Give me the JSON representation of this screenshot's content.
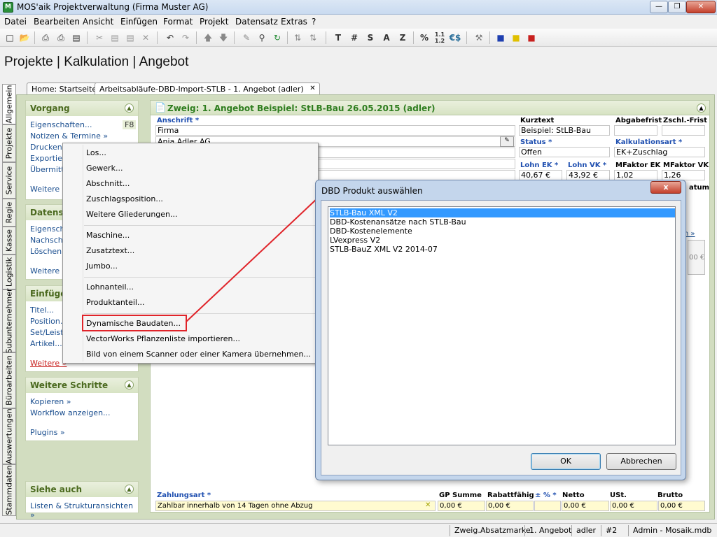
{
  "window": {
    "title": "MOS'aik Projektverwaltung (Firma Muster AG)",
    "app_icon": "M"
  },
  "menu": [
    "Datei",
    "Bearbeiten",
    "Ansicht",
    "Einfügen",
    "Format",
    "Projekt",
    "Datensatz",
    "Extras",
    "?"
  ],
  "toolbar": {
    "letters": [
      "T",
      "#",
      "S",
      "A",
      "Z",
      "%",
      "€$"
    ]
  },
  "page_heading": "Projekte | Kalkulation | Angebot",
  "tabs": {
    "home": "Home: Startseite",
    "doc": "Arbeitsabläufe-DBD-Import-STLB - 1. Angebot (adler)",
    "close": "✕"
  },
  "vtabs": [
    "Allgemein",
    "Projekte",
    "Service",
    "Regie",
    "Kasse",
    "Logistik",
    "Subunternehmer",
    "Büroarbeiten",
    "Auswertungen",
    "Stammdaten"
  ],
  "left": {
    "vorgang": {
      "title": "Vorgang",
      "items": [
        "Eigenschaften...",
        "Notizen & Termine »",
        "Drucken &",
        "Exportier",
        "Übermitte",
        "Weitere F"
      ],
      "shortcut": "F8"
    },
    "datensatz": {
      "title": "Datensa",
      "items": [
        "Eigensche",
        "Nachschla",
        "Löschen",
        "Weitere F"
      ]
    },
    "einfuegen": {
      "title": "Einfüger",
      "items": [
        "Titel...",
        "Position...",
        "Set/Leist",
        "Artikel...",
        "Weitere »"
      ]
    },
    "weitere": {
      "title": "Weitere Schritte",
      "items": [
        "Kopieren »",
        "Workflow anzeigen...",
        "Plugins »"
      ]
    },
    "siehe": {
      "title": "Siehe auch",
      "items": [
        "Listen & Strukturansichten »"
      ]
    }
  },
  "form": {
    "header": "Zweig: 1. Angebot Beispiel: StLB-Bau 26.05.2015 (adler)",
    "anschrift_label": "Anschrift *",
    "anschrift_lines": [
      "Firma",
      "Anja Adler AG"
    ],
    "kurztext_label": "Kurztext",
    "kurztext": "Beispiel: StLB-Bau",
    "abgabefrist_label": "Abgabefrist",
    "zschl_label": "Zschl.-Frist",
    "status_label": "Status *",
    "status": "Offen",
    "kalkart_label": "Kalkulationsart *",
    "kalkart": "EK+Zuschlag",
    "lohnek_label": "Lohn EK *",
    "lohnek": "40,67 €",
    "lohnvk_label": "Lohn VK *",
    "lohnvk": "43,92 €",
    "mfek_label": "MFaktor EK",
    "mfek": "1,02",
    "mfvk_label": "MFaktor VK",
    "mfvk": "1,26",
    "datum_partial": "atum",
    "link_partial": "chten »",
    "zero_partial": "00 €"
  },
  "footer": {
    "zahlungsart_label": "Zahlungsart *",
    "zahlungsart": "Zahlbar innerhalb von 14 Tagen ohne Abzug",
    "cols": [
      "GP Summe",
      "Rabattfähig",
      "± % *",
      "Netto",
      "USt.",
      "Brutto"
    ],
    "vals": [
      "0,00 €",
      "0,00 €",
      "",
      "0,00 €",
      "0,00 €",
      "0,00 €"
    ]
  },
  "context_menu": {
    "items": [
      "Los...",
      "Gewerk...",
      "Abschnitt...",
      "Zuschlagsposition...",
      "Weitere Gliederungen...",
      "Maschine...",
      "Zusatztext...",
      "Jumbo...",
      "Lohnanteil...",
      "Produktanteil...",
      "Dynamische Baudaten...",
      "VectorWorks Pflanzenliste importieren...",
      "Bild von einem Scanner oder einer Kamera übernehmen..."
    ],
    "highlighted": "Dynamische Baudaten..."
  },
  "dialog": {
    "title": "DBD Produkt auswählen",
    "close": "x",
    "items": [
      "STLB-Bau XML V2",
      "DBD-Kostenansätze nach STLB-Bau",
      "DBD-Kostenelemente",
      "LVexpress V2",
      "STLB-BauZ XML V2 2014-07"
    ],
    "selected_index": 0,
    "ok": "OK",
    "cancel": "Abbrechen"
  },
  "status": [
    "Zweig.Absatzmarke",
    "1. Angebot",
    "adler",
    "#2",
    "Admin - Mosaik.mdb"
  ],
  "colors": {
    "accent_green": "#4b6a1f",
    "highlight_red": "#e0242a",
    "selection_blue": "#3399ff"
  }
}
